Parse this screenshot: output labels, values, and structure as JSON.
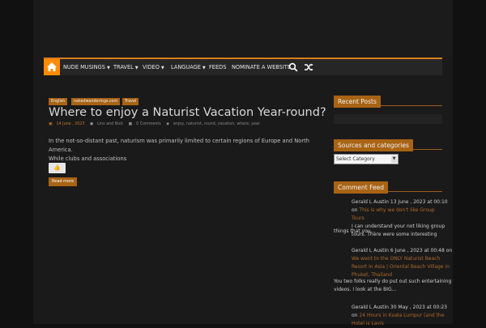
{
  "nav": {
    "items": [
      {
        "label": "NUDE MUSINGS",
        "has_caret": true
      },
      {
        "label": "TRAVEL",
        "has_caret": true
      },
      {
        "label": "VIDEO",
        "has_caret": true
      },
      {
        "label": "LANGUAGE",
        "has_caret": true
      },
      {
        "label": "FEEDS",
        "has_caret": false
      },
      {
        "label": "NOMINATE A WEBSITE",
        "has_caret": false
      }
    ],
    "icons": [
      "home-icon",
      "search-icon",
      "shuffle-icon"
    ]
  },
  "post": {
    "tags": [
      "English",
      "nakedwanderings.com",
      "Travel"
    ],
    "title": "Where to enjoy a Naturist Vacation Year-round?",
    "date": "14 June , 2023",
    "author": "Lins and Nick",
    "comments": "0 Comments",
    "keywords": "enjoy, naturist, round, vacation, where, year",
    "excerpt_line1": "In the not-so-distant past, naturism was primarily limited to certain regions of Europe and North America.",
    "excerpt_line2": "While clubs and associations",
    "read_more": "Read more"
  },
  "sidebar": {
    "recent_posts_title": "Recent Posts",
    "sources_title": "Sources and categories",
    "select_value": "Select Category",
    "comment_feed_title": "Comment Feed",
    "comments": [
      {
        "header": "Gerald L Austin 13 June , 2023 at 00:10",
        "on": "on",
        "link": "This is why we don't like Group Tours",
        "lines": [
          "I can understand your not liking group",
          "tours. There were some interesting"
        ],
        "tail": "things that you..."
      },
      {
        "header": "Gerald L Austin 6 June , 2023 at 00:48 on",
        "link_lines": [
          "We went to the ONLY Naturist Beach",
          "Resort in Asia | Oriental Beach Village in",
          "Phuket, Thailand"
        ],
        "lines": [
          "You two folks really do put out such entertaining",
          "videos. I look at the BIG..."
        ]
      },
      {
        "header": "Gerald L Austin 30 May , 2023 at 00:23",
        "on": "on",
        "link_lines": [
          "24 Hours in Kuala Lumpur (and the",
          "Hotel is Lavis"
        ]
      }
    ]
  },
  "colors": {
    "accent": "#ff8c00",
    "tag_bg": "#a86314",
    "nav_bg": "#262626",
    "page_bg": "#1a1a1a"
  }
}
